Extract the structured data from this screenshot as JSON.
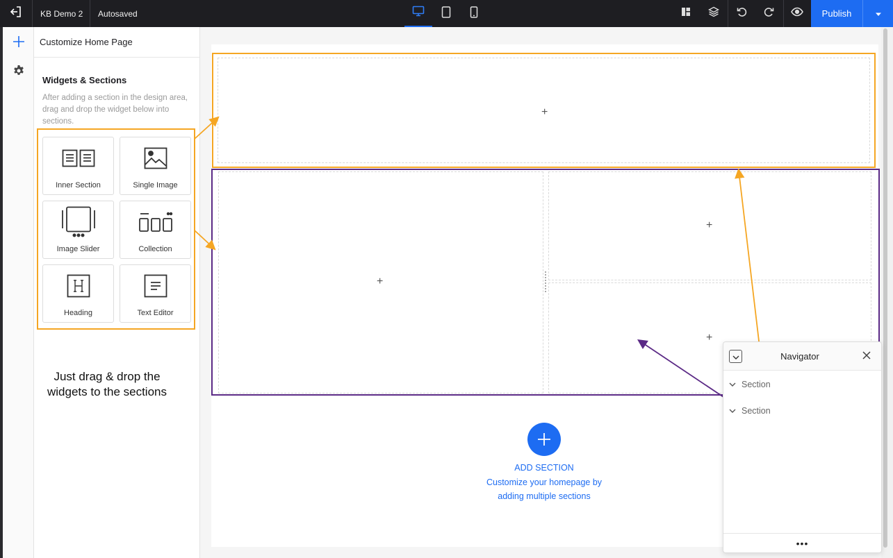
{
  "topbar": {
    "project_name": "KB Demo 2",
    "save_status": "Autosaved",
    "publish_label": "Publish",
    "active_device": "desktop"
  },
  "panel": {
    "title": "Customize Home Page",
    "section_heading": "Widgets & Sections",
    "section_description": "After adding a section in the design area, drag and drop the widget below into sections.",
    "widgets": [
      {
        "label": "Inner Section",
        "icon": "inner-section-icon"
      },
      {
        "label": "Single Image",
        "icon": "image-icon"
      },
      {
        "label": "Image Slider",
        "icon": "image-slider-icon"
      },
      {
        "label": "Collection",
        "icon": "collection-icon"
      },
      {
        "label": "Heading",
        "icon": "heading-icon"
      },
      {
        "label": "Text Editor",
        "icon": "text-editor-icon"
      }
    ],
    "hint": "Just drag & drop the widgets to the sections"
  },
  "canvas": {
    "add_section_label": "ADD SECTION",
    "add_section_desc_line1": "Customize your homepage by",
    "add_section_desc_line2": "adding multiple sections",
    "plus_symbol": "+"
  },
  "navigator": {
    "title": "Navigator",
    "items": [
      {
        "label": "Section"
      },
      {
        "label": "Section"
      }
    ],
    "more_label": "•••"
  },
  "colors": {
    "accent": "#1d6cf2",
    "topbar_bg": "#1e1e22",
    "highlight_orange": "#f5a623",
    "highlight_purple": "#5b2a86"
  }
}
